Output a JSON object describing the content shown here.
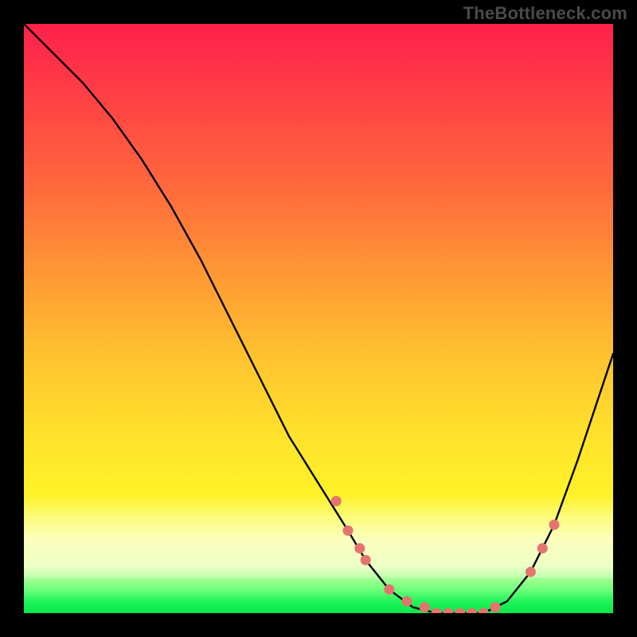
{
  "watermark": "TheBottleneck.com",
  "chart_data": {
    "type": "line",
    "title": "",
    "xlabel": "",
    "ylabel": "",
    "xlim": [
      0,
      100
    ],
    "ylim": [
      0,
      100
    ],
    "grid": false,
    "series": [
      {
        "name": "bottleneck-curve",
        "x": [
          0,
          5,
          10,
          15,
          20,
          25,
          30,
          35,
          40,
          45,
          50,
          55,
          58,
          62,
          66,
          70,
          74,
          78,
          82,
          86,
          90,
          94,
          100
        ],
        "values": [
          100,
          95,
          90,
          84,
          77,
          69,
          60,
          50,
          40,
          30,
          22,
          14,
          9,
          4,
          1,
          0,
          0,
          0,
          2,
          7,
          15,
          26,
          44
        ]
      }
    ],
    "markers": {
      "name": "highlight-points",
      "color": "#e4746f",
      "x": [
        53,
        55,
        57,
        58,
        62,
        65,
        68,
        70,
        72,
        74,
        76,
        78,
        80,
        86,
        88,
        90
      ],
      "values": [
        19,
        14,
        11,
        9,
        4,
        2,
        1,
        0,
        0,
        0,
        0,
        0,
        1,
        7,
        11,
        15
      ]
    },
    "background_gradient": {
      "top": "#ff1f4b",
      "mid": "#ffe22b",
      "bottom": "#07e84a"
    }
  }
}
